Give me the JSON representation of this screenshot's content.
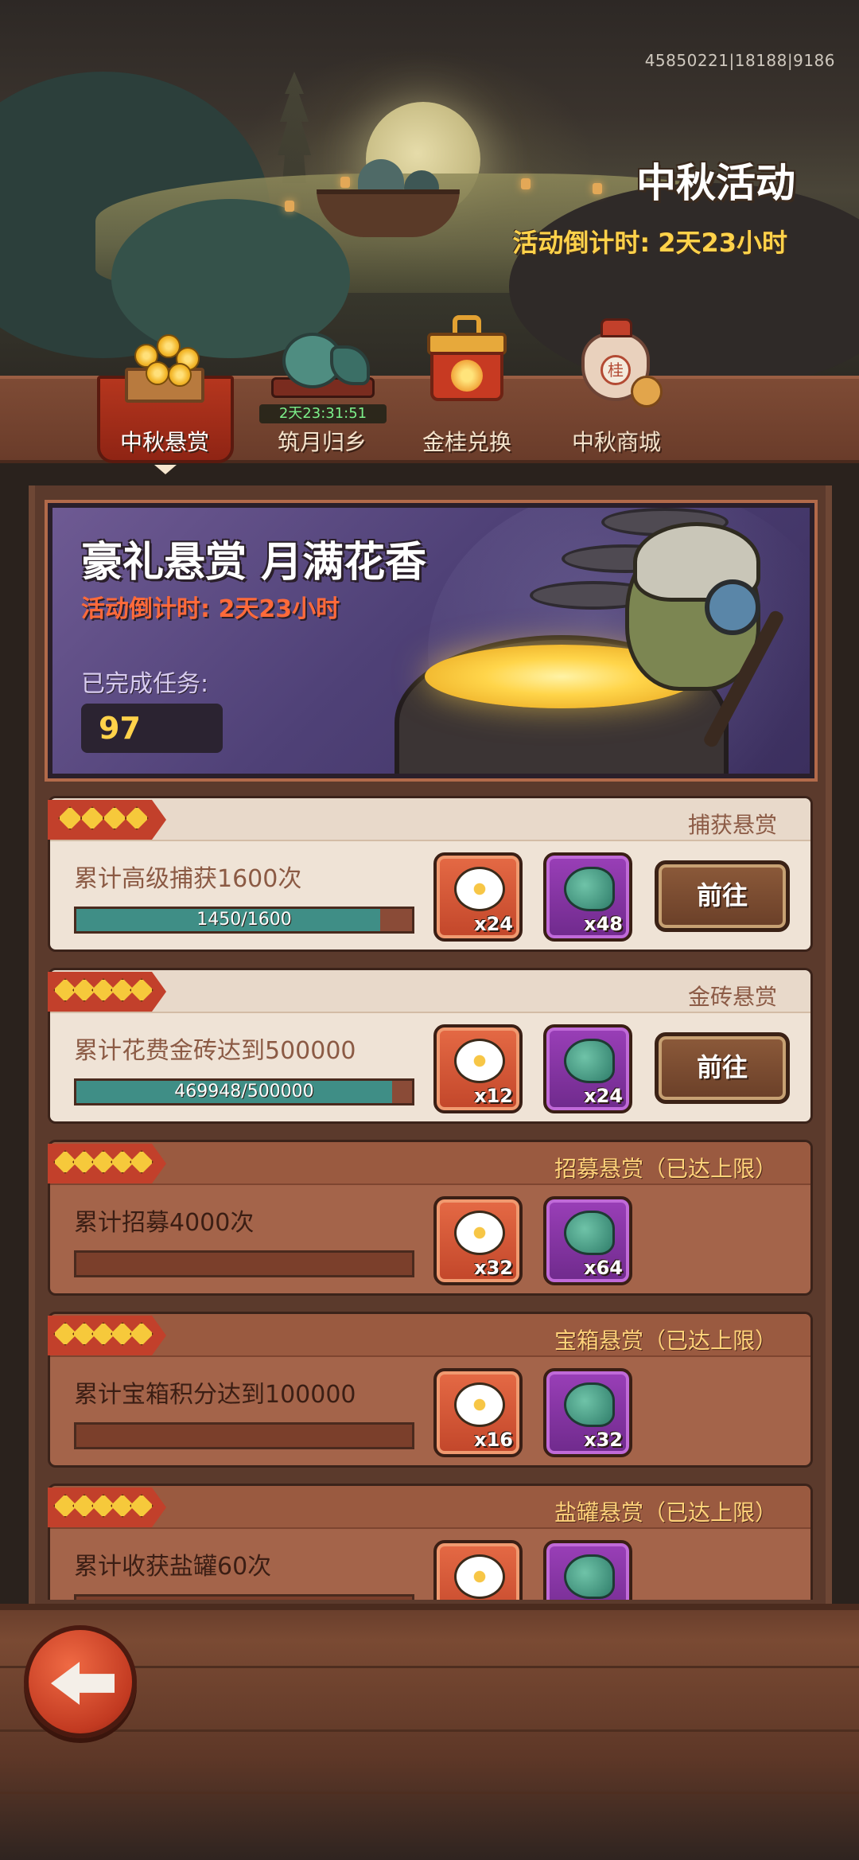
{
  "header": {
    "uid": "45850221|18188|9186",
    "title": "中秋活动",
    "countdown_label": "活动倒计时:",
    "countdown_value": "2天23小时"
  },
  "tabs": [
    {
      "label": "中秋悬赏",
      "icon": "osmanthus-crate-icon",
      "active": true
    },
    {
      "label": "筑月归乡",
      "icon": "jade-frog-icon",
      "timer": "2天23:31:51"
    },
    {
      "label": "金桂兑换",
      "icon": "treasure-box-icon"
    },
    {
      "label": "中秋商城",
      "icon": "wine-jar-icon",
      "seal": "桂"
    }
  ],
  "banner": {
    "title": "豪礼悬赏 月满花香",
    "countdown": "活动倒计时: 2天23小时",
    "completed_label": "已完成任务:",
    "completed_value": "97"
  },
  "tasks": [
    {
      "stars": 4,
      "category": "捕获悬赏",
      "desc": "累计高级捕获1600次",
      "progress_text": "1450/1600",
      "progress": 0.906,
      "rewards": [
        {
          "icon": "osmanthus-flower-icon",
          "qty": "x24"
        },
        {
          "icon": "jade-swirl-icon",
          "qty": "x48"
        }
      ],
      "button": "前往",
      "maxed": false
    },
    {
      "stars": 5,
      "category": "金砖悬赏",
      "desc": "累计花费金砖达到500000",
      "progress_text": "469948/500000",
      "progress": 0.94,
      "rewards": [
        {
          "icon": "osmanthus-flower-icon",
          "qty": "x12"
        },
        {
          "icon": "jade-swirl-icon",
          "qty": "x24"
        }
      ],
      "button": "前往",
      "maxed": false
    },
    {
      "stars": 5,
      "category": "招募悬赏（已达上限）",
      "desc": "累计招募4000次",
      "progress_text": "",
      "progress": 0,
      "rewards": [
        {
          "icon": "osmanthus-flower-icon",
          "qty": "x32"
        },
        {
          "icon": "jade-swirl-icon",
          "qty": "x64"
        }
      ],
      "maxed": true
    },
    {
      "stars": 5,
      "category": "宝箱悬赏（已达上限）",
      "desc": "累计宝箱积分达到100000",
      "progress_text": "",
      "progress": 0,
      "rewards": [
        {
          "icon": "osmanthus-flower-icon",
          "qty": "x16"
        },
        {
          "icon": "jade-swirl-icon",
          "qty": "x32"
        }
      ],
      "maxed": true
    },
    {
      "stars": 5,
      "category": "盐罐悬赏（已达上限）",
      "desc": "累计收获盐罐60次",
      "progress_text": "",
      "progress": 0,
      "rewards": [
        {
          "icon": "osmanthus-flower-icon",
          "qty": ""
        },
        {
          "icon": "jade-swirl-icon",
          "qty": ""
        }
      ],
      "maxed": true
    }
  ],
  "footer": {
    "back_icon": "back-arrow-icon"
  },
  "colors": {
    "accent_red": "#c2402b",
    "gold": "#ffd24a",
    "progress_teal": "#3f8e86",
    "banner_purple": "#4f4177"
  }
}
